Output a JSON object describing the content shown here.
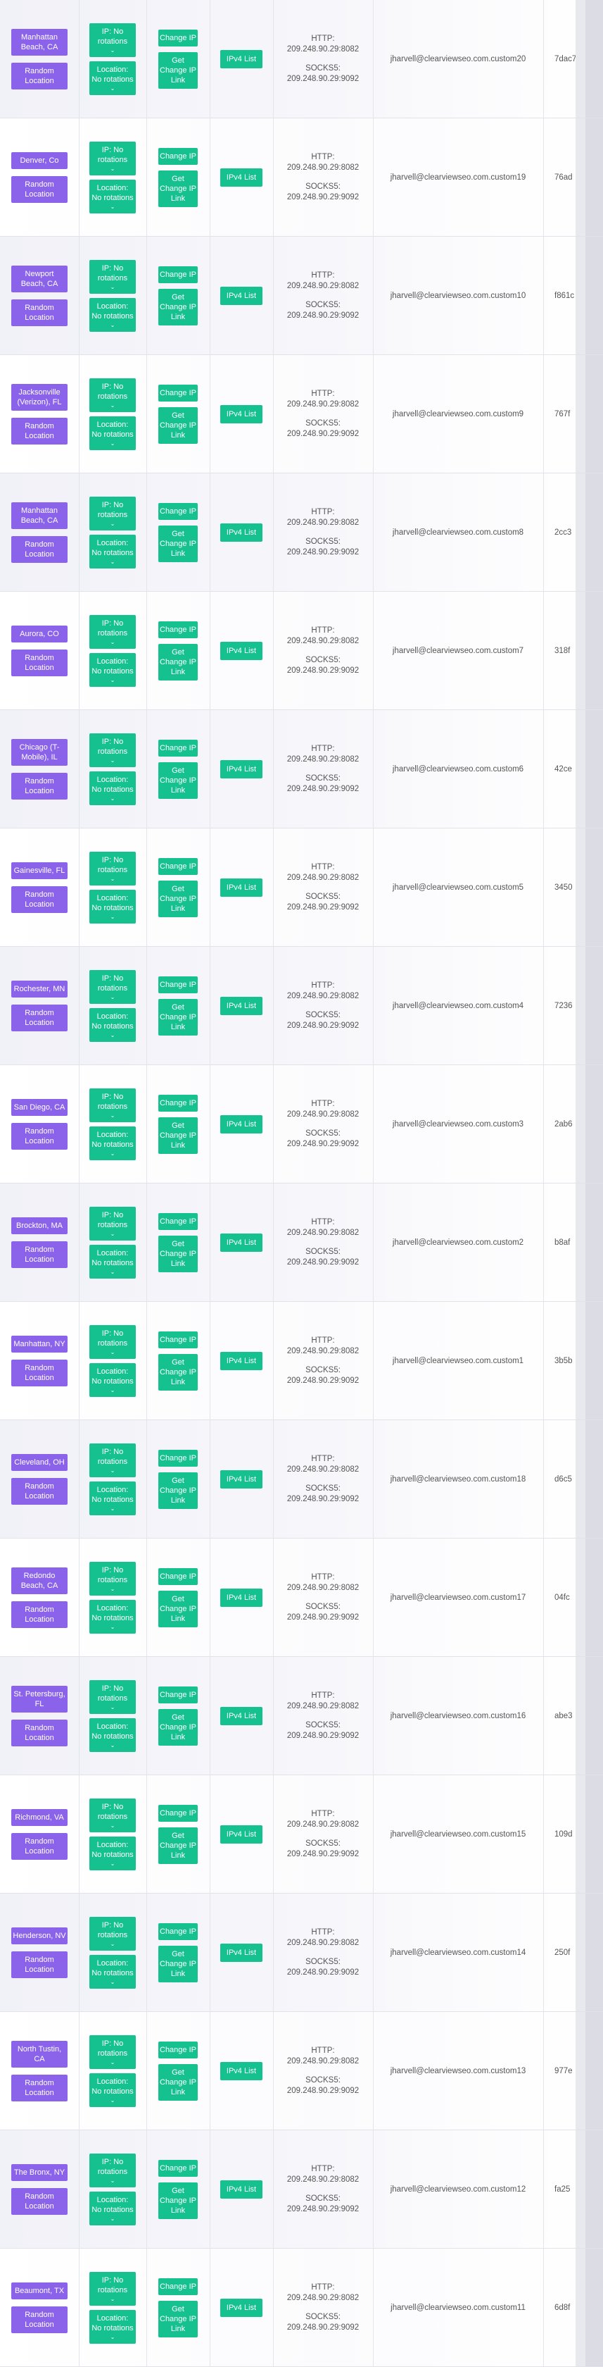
{
  "labels": {
    "random_location": "Random Location",
    "ip_rotation": "IP: No rotations",
    "location_rotation": "Location: No rotations",
    "change_ip": "Change IP",
    "get_change_ip_link": "Get Change IP Link",
    "ipv4_list": "IPv4 List",
    "http_label": "HTTP:",
    "socks_label": "SOCKS5:",
    "http_value": "209.248.90.29:8082",
    "socks_value": "209.248.90.29:9092",
    "caret": "⌄"
  },
  "colors": {
    "purple": "#8a63ea",
    "green": "#15c28f"
  },
  "rows": [
    {
      "location": "Manhattan Beach, CA",
      "username": "jharvell@clearviewseo.com.custom20",
      "password": "7dac7"
    },
    {
      "location": "Denver, Co",
      "username": "jharvell@clearviewseo.com.custom19",
      "password": "76ad"
    },
    {
      "location": "Newport Beach, CA",
      "username": "jharvell@clearviewseo.com.custom10",
      "password": "f861c"
    },
    {
      "location": "Jacksonville (Verizon), FL",
      "username": "jharvell@clearviewseo.com.custom9",
      "password": "767f"
    },
    {
      "location": "Manhattan Beach, CA",
      "username": "jharvell@clearviewseo.com.custom8",
      "password": "2cc3"
    },
    {
      "location": "Aurora, CO",
      "username": "jharvell@clearviewseo.com.custom7",
      "password": "318f"
    },
    {
      "location": "Chicago (T-Mobile), IL",
      "username": "jharvell@clearviewseo.com.custom6",
      "password": "42ce"
    },
    {
      "location": "Gainesville, FL",
      "username": "jharvell@clearviewseo.com.custom5",
      "password": "3450"
    },
    {
      "location": "Rochester, MN",
      "username": "jharvell@clearviewseo.com.custom4",
      "password": "7236"
    },
    {
      "location": "San Diego, CA",
      "username": "jharvell@clearviewseo.com.custom3",
      "password": "2ab6"
    },
    {
      "location": "Brockton, MA",
      "username": "jharvell@clearviewseo.com.custom2",
      "password": "b8af"
    },
    {
      "location": "Manhattan, NY",
      "username": "jharvell@clearviewseo.com.custom1",
      "password": "3b5b"
    },
    {
      "location": "Cleveland, OH",
      "username": "jharvell@clearviewseo.com.custom18",
      "password": "d6c5"
    },
    {
      "location": "Redondo Beach, CA",
      "username": "jharvell@clearviewseo.com.custom17",
      "password": "04fc"
    },
    {
      "location": "St. Petersburg, FL",
      "username": "jharvell@clearviewseo.com.custom16",
      "password": "abe3"
    },
    {
      "location": "Richmond, VA",
      "username": "jharvell@clearviewseo.com.custom15",
      "password": "109d"
    },
    {
      "location": "Henderson, NV",
      "username": "jharvell@clearviewseo.com.custom14",
      "password": "250f"
    },
    {
      "location": "North Tustin, CA",
      "username": "jharvell@clearviewseo.com.custom13",
      "password": "977e"
    },
    {
      "location": "The Bronx, NY",
      "username": "jharvell@clearviewseo.com.custom12",
      "password": "fa25"
    },
    {
      "location": "Beaumont, TX",
      "username": "jharvell@clearviewseo.com.custom11",
      "password": "6d8f"
    }
  ]
}
